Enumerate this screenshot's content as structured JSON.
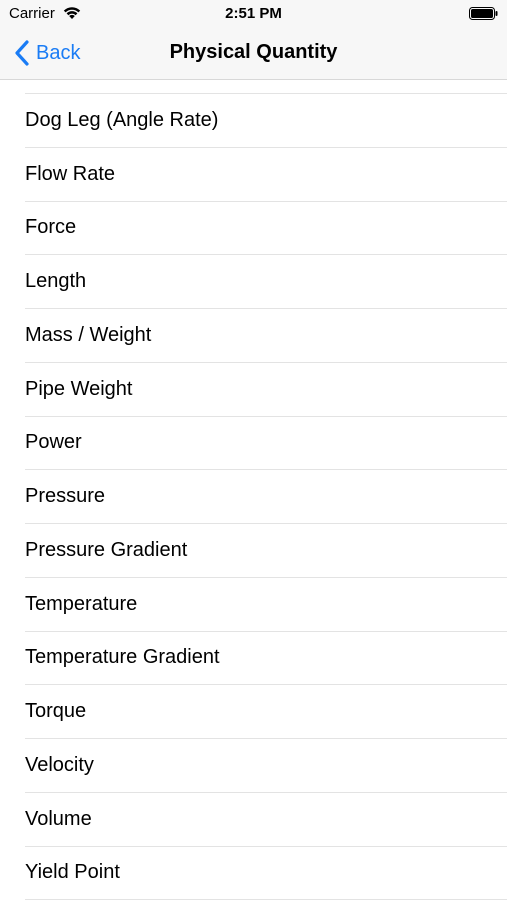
{
  "status_bar": {
    "carrier": "Carrier",
    "time": "2:51 PM",
    "icons": [
      "wifi-icon",
      "battery-icon"
    ]
  },
  "nav": {
    "back_label": "Back",
    "title": "Physical Quantity",
    "accent_color": "#1a7cf5"
  },
  "quantities": [
    "Dog Leg (Angle Rate)",
    "Flow Rate",
    "Force",
    "Length",
    "Mass / Weight",
    "Pipe Weight",
    "Power",
    "Pressure",
    "Pressure Gradient",
    "Temperature",
    "Temperature Gradient",
    "Torque",
    "Velocity",
    "Volume",
    "Yield Point"
  ]
}
